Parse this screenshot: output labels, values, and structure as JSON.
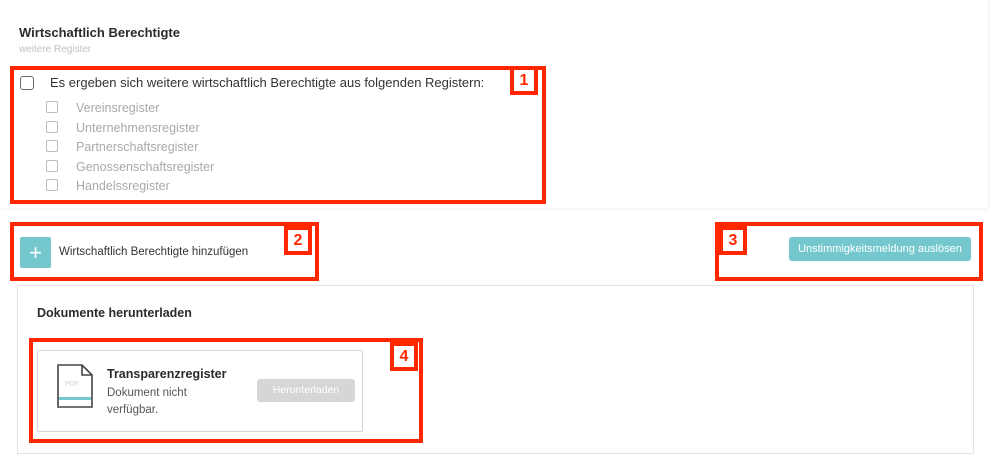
{
  "beneficiaries": {
    "title": "Wirtschaftlich Berechtigte",
    "subtitle": "weitere Register",
    "main_checkbox_label": "Es ergeben sich weitere wirtschaftlich Berechtigte aus folgenden Registern:",
    "registers": [
      {
        "label": "Vereinsregister"
      },
      {
        "label": "Unternehmensregister"
      },
      {
        "label": "Partnerschaftsregister"
      },
      {
        "label": "Genossenschaftsregister"
      },
      {
        "label": "Handelssregister"
      }
    ]
  },
  "actions": {
    "add_icon": "plus-icon",
    "add_label": "Wirtschaftlich Berechtigte hinzufügen",
    "discrepancy_button": "Unstimmigkeitsmeldung auslösen"
  },
  "documents": {
    "title": "Dokumente herunterladen",
    "items": [
      {
        "icon": "pdf-file-icon",
        "icon_text": "PDF",
        "name": "Transparenzregister",
        "status": "Dokument nicht verfügbar.",
        "button": "Herunterladen"
      }
    ]
  },
  "annotations": [
    "1",
    "2",
    "3",
    "4"
  ],
  "colors": {
    "accent": "#74c8cd",
    "annotation": "#ff2600",
    "disabled": "#d6d6d6"
  }
}
